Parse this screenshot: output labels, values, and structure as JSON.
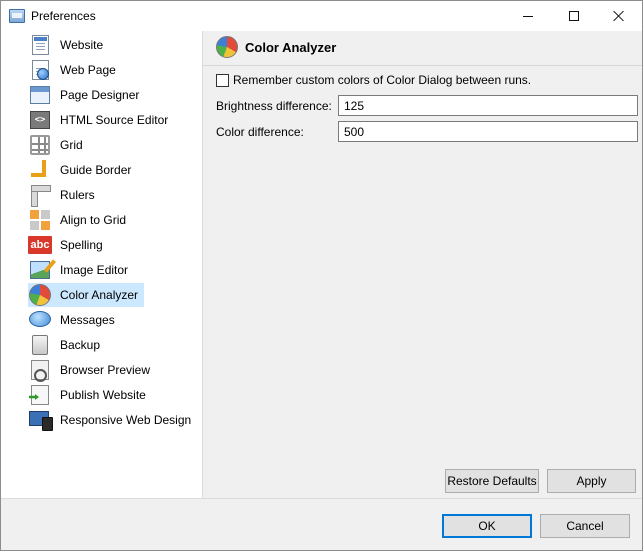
{
  "window": {
    "title": "Preferences"
  },
  "sidebar": {
    "items": [
      {
        "label": "Website",
        "icon": "website-icon"
      },
      {
        "label": "Web Page",
        "icon": "web-page-icon"
      },
      {
        "label": "Page Designer",
        "icon": "page-designer-icon"
      },
      {
        "label": "HTML Source Editor",
        "icon": "html-source-editor-icon"
      },
      {
        "label": "Grid",
        "icon": "grid-icon"
      },
      {
        "label": "Guide Border",
        "icon": "guide-border-icon"
      },
      {
        "label": "Rulers",
        "icon": "rulers-icon"
      },
      {
        "label": "Align to Grid",
        "icon": "align-to-grid-icon"
      },
      {
        "label": "Spelling",
        "icon": "spelling-icon"
      },
      {
        "label": "Image Editor",
        "icon": "image-editor-icon"
      },
      {
        "label": "Color Analyzer",
        "icon": "color-analyzer-icon",
        "selected": true
      },
      {
        "label": "Messages",
        "icon": "messages-icon"
      },
      {
        "label": "Backup",
        "icon": "backup-icon"
      },
      {
        "label": "Browser Preview",
        "icon": "browser-preview-icon"
      },
      {
        "label": "Publish Website",
        "icon": "publish-website-icon"
      },
      {
        "label": "Responsive Web Design",
        "icon": "responsive-web-design-icon"
      }
    ]
  },
  "panel": {
    "title": "Color Analyzer",
    "remember_checkbox": {
      "label": "Remember custom colors of Color Dialog between runs.",
      "checked": false
    },
    "brightness": {
      "label": "Brightness difference:",
      "value": "125"
    },
    "color_diff": {
      "label": "Color difference:",
      "value": "500"
    },
    "restore_label": "Restore Defaults",
    "apply_label": "Apply"
  },
  "footer": {
    "ok_label": "OK",
    "cancel_label": "Cancel"
  },
  "colors": {
    "selection": "#cce8ff",
    "panel_bg": "#f0f0f0",
    "primary_border": "#0078d7"
  }
}
